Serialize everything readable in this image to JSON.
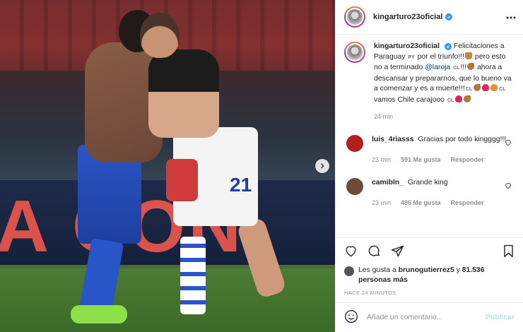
{
  "post": {
    "author": "kingarturo23oficial",
    "photo": {
      "board_text": "A CON",
      "jersey_number": "21"
    },
    "caption": {
      "username": "kingarturo23oficial",
      "parts": {
        "p1": "Felicitaciones a Paraguay",
        "flag_py": "PY",
        "p2": "por el triunfo!!!",
        "p3": "pero esto no a terminado",
        "mention": "@laroja",
        "flag_cl_1": "CL",
        "p4": "!!!",
        "p5": "ahora a descansar y prepararnos, que lo bueno va a comenzar y es a muerte!!!",
        "flag_cl_2": "CL",
        "flag_cl_3": "CL",
        "p6": "vamos Chile carajooo",
        "flag_cl_4": "CL"
      },
      "time": "24 min"
    },
    "comments": [
      {
        "username": "luis_4riasss",
        "text": "Gracias por todo kingggg!!!",
        "time": "23 min",
        "likes": "591 Me gusta",
        "reply": "Responder",
        "avatar_color": "#b21f1f"
      },
      {
        "username": "camibln_",
        "text": "Grande king",
        "time": "23 min",
        "likes": "486 Me gusta",
        "reply": "Responder",
        "avatar_color": "#6d4a3a"
      }
    ],
    "likes_line": {
      "prefix": "Les gusta a",
      "user": "brunogutierrez5",
      "mid": "y",
      "count": "81.536 personas más"
    },
    "ago": "HACE 24 MINUTOS",
    "add_comment": {
      "placeholder": "Añade un comentario...",
      "publish": "Publicar"
    },
    "colors": {
      "verified": "#3897f0",
      "publish_disabled": "#b2dffc",
      "meta": "#8e8e8e"
    },
    "icons": [
      "more-icon",
      "verified-icon",
      "heart-icon",
      "comment-icon",
      "share-icon",
      "save-icon",
      "emoji-icon",
      "chevron-right-icon"
    ]
  }
}
